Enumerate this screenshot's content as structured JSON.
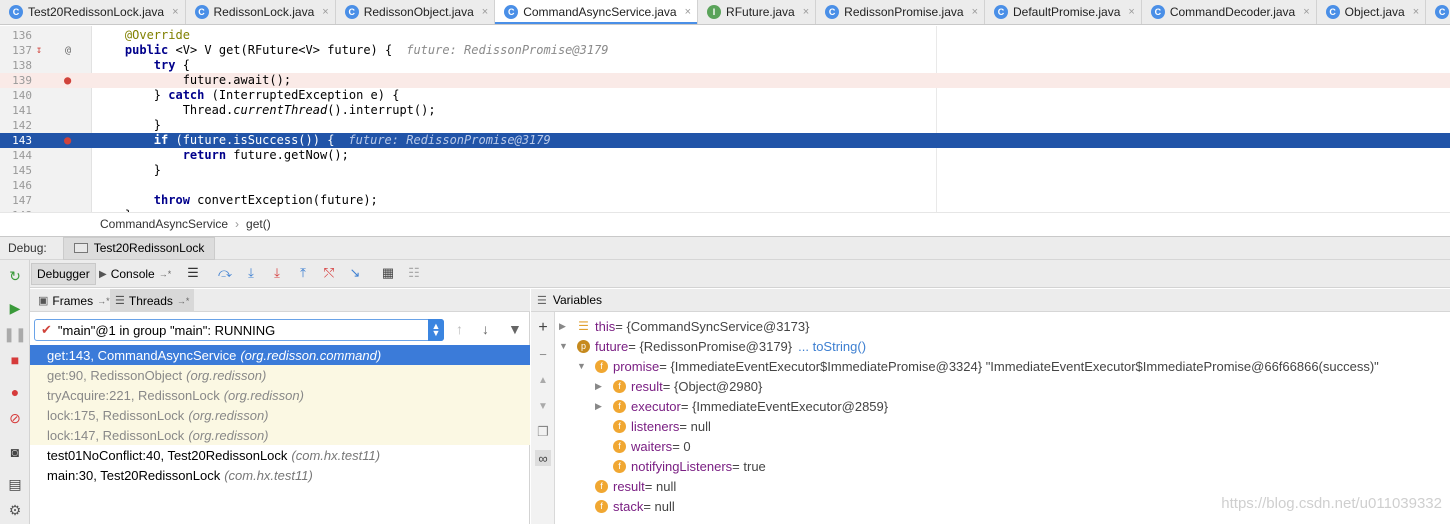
{
  "tabs": [
    {
      "label": "Test20RedissonLock.java",
      "icon": "class-icon",
      "icon_color": "#4a8fe7",
      "active": false
    },
    {
      "label": "RedissonLock.java",
      "icon": "class-icon",
      "icon_color": "#4a8fe7",
      "active": false
    },
    {
      "label": "RedissonObject.java",
      "icon": "class-icon",
      "icon_color": "#4a8fe7",
      "active": false
    },
    {
      "label": "CommandAsyncService.java",
      "icon": "class-icon",
      "icon_color": "#4a8fe7",
      "active": true
    },
    {
      "label": "RFuture.java",
      "icon": "interface-icon",
      "icon_color": "#5aa35a",
      "active": false
    },
    {
      "label": "RedissonPromise.java",
      "icon": "class-icon",
      "icon_color": "#4a8fe7",
      "active": false
    },
    {
      "label": "DefaultPromise.java",
      "icon": "class-icon",
      "icon_color": "#4a8fe7",
      "active": false
    },
    {
      "label": "CommandDecoder.java",
      "icon": "class-icon",
      "icon_color": "#4a8fe7",
      "active": false
    },
    {
      "label": "Object.java",
      "icon": "class-icon",
      "icon_color": "#4a8fe7",
      "active": false
    },
    {
      "label": "Promis",
      "icon": "class-icon",
      "icon_color": "#4a8fe7",
      "active": false
    }
  ],
  "editor": {
    "lines": [
      {
        "n": "136",
        "indent": "    ",
        "parts": [
          {
            "t": "@Override",
            "c": "ann"
          }
        ]
      },
      {
        "n": "137",
        "indent": "    ",
        "parts": [
          {
            "t": "public",
            "c": "kw"
          },
          {
            "t": " <V> V get(RFuture<V> future) {",
            "c": ""
          }
        ],
        "hint": "future: RedissonPromise@3179"
      },
      {
        "n": "138",
        "indent": "        ",
        "parts": [
          {
            "t": "try",
            "c": "kw"
          },
          {
            "t": " {",
            "c": ""
          }
        ]
      },
      {
        "n": "139",
        "indent": "            ",
        "parts": [
          {
            "t": "future.await();",
            "c": ""
          }
        ],
        "state": "red"
      },
      {
        "n": "140",
        "indent": "        ",
        "parts": [
          {
            "t": "} ",
            "c": ""
          },
          {
            "t": "catch",
            "c": "kw"
          },
          {
            "t": " (InterruptedException e) {",
            "c": ""
          }
        ]
      },
      {
        "n": "141",
        "indent": "            ",
        "parts": [
          {
            "t": "Thread.",
            "c": ""
          },
          {
            "t": "currentThread",
            "c": "it"
          },
          {
            "t": "().interrupt();",
            "c": ""
          }
        ]
      },
      {
        "n": "142",
        "indent": "        ",
        "parts": [
          {
            "t": "}",
            "c": ""
          }
        ]
      },
      {
        "n": "143",
        "indent": "        ",
        "parts": [
          {
            "t": "if",
            "c": "kw"
          },
          {
            "t": " (future.isSuccess()) {",
            "c": ""
          }
        ],
        "hint": "future: RedissonPromise@3179",
        "state": "sel"
      },
      {
        "n": "144",
        "indent": "            ",
        "parts": [
          {
            "t": "return",
            "c": "kw"
          },
          {
            "t": " future.getNow();",
            "c": ""
          }
        ]
      },
      {
        "n": "145",
        "indent": "        ",
        "parts": [
          {
            "t": "}",
            "c": ""
          }
        ]
      },
      {
        "n": "146",
        "indent": "",
        "parts": []
      },
      {
        "n": "147",
        "indent": "        ",
        "parts": [
          {
            "t": "throw",
            "c": "kw"
          },
          {
            "t": " convertException(future);",
            "c": ""
          }
        ]
      },
      {
        "n": "148",
        "indent": "    ",
        "parts": [
          {
            "t": "}",
            "c": ""
          }
        ]
      }
    ]
  },
  "breadcrumb": {
    "class": "CommandAsyncService",
    "method": "get()"
  },
  "debug": {
    "label": "Debug:",
    "session": "Test20RedissonLock"
  },
  "subtabs": {
    "debugger": "Debugger",
    "console": "Console",
    "console_suffix": "→*"
  },
  "frames": {
    "frames_tab": "Frames",
    "threads_tab": "Threads",
    "suffix": "→*",
    "thread_label": "\"main\"@1 in group \"main\": RUNNING",
    "items": [
      {
        "method": "get:143, CommandAsyncService",
        "pkg": "(org.redisson.command)",
        "style": "sel"
      },
      {
        "method": "get:90, RedissonObject",
        "pkg": "(org.redisson)",
        "style": "lib"
      },
      {
        "method": "tryAcquire:221, RedissonLock",
        "pkg": "(org.redisson)",
        "style": "lib"
      },
      {
        "method": "lock:175, RedissonLock",
        "pkg": "(org.redisson)",
        "style": "lib"
      },
      {
        "method": "lock:147, RedissonLock",
        "pkg": "(org.redisson)",
        "style": "lib"
      },
      {
        "method": "test01NoConflict:40, Test20RedissonLock",
        "pkg": "(com.hx.test11)",
        "style": "norm"
      },
      {
        "method": "main:30, Test20RedissonLock",
        "pkg": "(com.hx.test11)",
        "style": "norm"
      }
    ]
  },
  "variables": {
    "title": "Variables",
    "items": [
      {
        "depth": 0,
        "exp": "right",
        "icon": "list",
        "name": "this",
        "value": " = {CommandSyncService@3173}",
        "link": ""
      },
      {
        "depth": 0,
        "exp": "down",
        "icon": "p",
        "name": "future",
        "value": " = {RedissonPromise@3179}",
        "link": "... toString()"
      },
      {
        "depth": 1,
        "exp": "down",
        "icon": "f",
        "name": "promise",
        "value": " = {ImmediateEventExecutor$ImmediatePromise@3324} \"ImmediateEventExecutor$ImmediatePromise@66f66866(success)\"",
        "link": ""
      },
      {
        "depth": 2,
        "exp": "right",
        "icon": "f",
        "name": "result",
        "value": " = {Object@2980}",
        "link": ""
      },
      {
        "depth": 2,
        "exp": "right",
        "icon": "f",
        "name": "executor",
        "value": " = {ImmediateEventExecutor@2859}",
        "link": ""
      },
      {
        "depth": 2,
        "exp": "",
        "icon": "f",
        "name": "listeners",
        "value": " = null",
        "link": ""
      },
      {
        "depth": 2,
        "exp": "",
        "icon": "f",
        "name": "waiters",
        "value": " = 0",
        "link": ""
      },
      {
        "depth": 2,
        "exp": "",
        "icon": "f",
        "name": "notifyingListeners",
        "value": " = true",
        "link": ""
      },
      {
        "depth": 1,
        "exp": "",
        "icon": "f",
        "name": "result",
        "value": " = null",
        "link": ""
      },
      {
        "depth": 1,
        "exp": "",
        "icon": "f",
        "name": "stack",
        "value": " = null",
        "link": ""
      }
    ]
  },
  "watermark": "https://blog.csdn.net/u011039332",
  "colors": {
    "selection": "#2154a8",
    "frame_selection": "#3b7bd9",
    "library_frame_bg": "#fbf8e3",
    "breakpoint_line": "#faeae7",
    "accent": "#4a8fe7"
  }
}
